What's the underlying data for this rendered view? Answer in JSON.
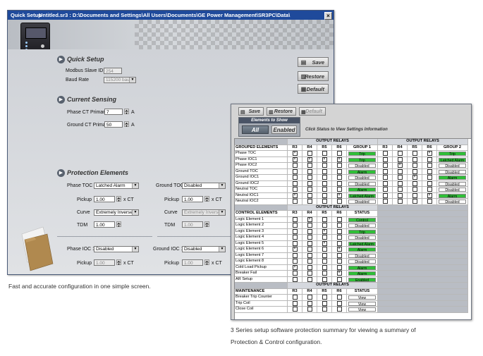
{
  "window1": {
    "title": "Quick Setup",
    "path": "Untitled.sr3 : D:\\Documents and Settings\\All Users\\Documents\\GE Power Management\\SR3PC\\Data\\",
    "close_glyph": "×",
    "quick_setup": {
      "heading": "Quick Setup",
      "modbus_label": "Modbus Slave ID",
      "modbus_value": "254",
      "baud_label": "Baud Rate",
      "baud_value": "115200 baud"
    },
    "current_sensing": {
      "heading": "Current Sensing",
      "phase_ct_label": "Phase CT Primary",
      "phase_ct_value": "7",
      "phase_ct_unit": "A",
      "ground_ct_label": "Ground CT Primary",
      "ground_ct_value": "50",
      "ground_ct_unit": "A"
    },
    "protection": {
      "heading": "Protection Elements",
      "phase_toc_label": "Phase TOC",
      "phase_toc_value": "Latched Alarm",
      "ground_toc_label": "Ground TOC",
      "ground_toc_value": "Disabled",
      "pickup_label": "Pickup",
      "pickup_value_left": "1.00",
      "pickup_value_right": "1.00",
      "pickup_unit": "x CT",
      "curve_label": "Curve",
      "curve_value_left": "Extremely Inverse",
      "curve_value_right": "Extremely Inverse",
      "tdm_label": "TDM",
      "tdm_value_left": "1.00",
      "tdm_value_right": "1.00",
      "phase_ioc_label": "Phase IOC 1",
      "phase_ioc_value": "Disabled",
      "ground_ioc_label": "Ground IOC 1",
      "ground_ioc_value": "Disabled",
      "ioc_pickup_label": "Pickup",
      "ioc_pickup_left": "1.00",
      "ioc_pickup_right": "1.00",
      "ioc_pickup_unit": "x CT"
    },
    "buttons": {
      "save": "Save",
      "restore": "Restore",
      "default": "Default"
    }
  },
  "caption1": "Fast and accurate configuration in one simple screen.",
  "window2": {
    "toolbar": {
      "save": "Save",
      "restore": "Restore",
      "default": "Default"
    },
    "elements_to_show": {
      "heading": "Elements to Show",
      "all": "All",
      "enabled": "Enabled"
    },
    "hint": "Click Status to View Settings Information",
    "output_relays_label": "OUTPUT RELAYS",
    "relay_cols": [
      "R3",
      "R4",
      "R5",
      "R6"
    ],
    "grouped": {
      "header": "GROUPED ELEMENTS",
      "group1_label": "GROUP 1",
      "group2_label": "GROUP 2",
      "rows": [
        {
          "name": "Phase TOC",
          "g1": [
            1,
            0,
            0,
            0
          ],
          "s1": "Trip",
          "s1c": "green",
          "g2": [
            0,
            0,
            0,
            1
          ],
          "s2": "Trip",
          "s2c": "green"
        },
        {
          "name": "Phase IOC1",
          "g1": [
            1,
            1,
            1,
            1
          ],
          "s1": "Trip",
          "s1c": "green",
          "g2": [
            0,
            0,
            0,
            0
          ],
          "s2": "Latched Alarm",
          "s2c": "green"
        },
        {
          "name": "Phase IOC2",
          "g1": [
            0,
            0,
            0,
            0
          ],
          "s1": "Disabled",
          "s1c": "white",
          "g2": [
            0,
            1,
            0,
            0
          ],
          "s2": "Disabled",
          "s2c": "white"
        },
        {
          "name": "Ground TOC",
          "g1": [
            0,
            0,
            0,
            0
          ],
          "s1": "Alarm",
          "s1c": "green",
          "g2": [
            0,
            0,
            0,
            0
          ],
          "s2": "Disabled",
          "s2c": "white"
        },
        {
          "name": "Ground IOC1",
          "g1": [
            0,
            0,
            0,
            0
          ],
          "s1": "Disabled",
          "s1c": "white",
          "g2": [
            0,
            0,
            1,
            0
          ],
          "s2": "Alarm",
          "s2c": "green"
        },
        {
          "name": "Ground IOC2",
          "g1": [
            0,
            0,
            0,
            0
          ],
          "s1": "Disabled",
          "s1c": "white",
          "g2": [
            0,
            0,
            0,
            0
          ],
          "s2": "Disabled",
          "s2c": "white"
        },
        {
          "name": "Neutral TOC",
          "g1": [
            0,
            0,
            0,
            0
          ],
          "s1": "Alarm",
          "s1c": "green",
          "g2": [
            0,
            0,
            0,
            0
          ],
          "s2": "Disabled",
          "s2c": "white"
        },
        {
          "name": "Neutral IOC1",
          "g1": [
            1,
            0,
            0,
            1
          ],
          "s1": "Latched Alarm",
          "s1c": "green",
          "g2": [
            0,
            0,
            0,
            1
          ],
          "s2": "Alarm",
          "s2c": "green"
        },
        {
          "name": "Neutral IOC2",
          "g1": [
            0,
            0,
            0,
            0
          ],
          "s1": "Disabled",
          "s1c": "white",
          "g2": [
            0,
            0,
            0,
            0
          ],
          "s2": "Disabled",
          "s2c": "white"
        }
      ]
    },
    "control": {
      "header": "CONTROL ELEMENTS",
      "status_label": "STATUS",
      "rows": [
        {
          "name": "Logic Element 1",
          "r": [
            0,
            1,
            0,
            0
          ],
          "s": "Control",
          "c": "green"
        },
        {
          "name": "Logic Element 2",
          "r": [
            0,
            0,
            0,
            0
          ],
          "s": "Disabled",
          "c": "white"
        },
        {
          "name": "Logic Element 3",
          "r": [
            0,
            0,
            1,
            0
          ],
          "s": "Trip",
          "c": "green"
        },
        {
          "name": "Logic Element 4",
          "r": [
            0,
            0,
            0,
            0
          ],
          "s": "Disabled",
          "c": "white"
        },
        {
          "name": "Logic Element 5",
          "r": [
            0,
            0,
            1,
            0
          ],
          "s": "Latched Alarm",
          "c": "green"
        },
        {
          "name": "Logic Element 6",
          "r": [
            1,
            0,
            0,
            1
          ],
          "s": "Alarm",
          "c": "green"
        },
        {
          "name": "Logic Element 7",
          "r": [
            0,
            0,
            0,
            0
          ],
          "s": "Disabled",
          "c": "white"
        },
        {
          "name": "Logic Element 8",
          "r": [
            0,
            0,
            0,
            0
          ],
          "s": "Disabled",
          "c": "white"
        },
        {
          "name": "Cold Load Pickup",
          "r": [
            1,
            0,
            0,
            0
          ],
          "s": "Alarm",
          "c": "green"
        },
        {
          "name": "Breaker Fail",
          "r": [
            0,
            0,
            0,
            1
          ],
          "s": "Alarm",
          "c": "green"
        },
        {
          "name": "AR Setup",
          "r": [
            0,
            0,
            0,
            0
          ],
          "s": "Enabled",
          "c": "green"
        }
      ]
    },
    "maintenance": {
      "header": "MAINTENANCE",
      "status_label": "STATUS",
      "rows": [
        {
          "name": "Breaker Trip Counter",
          "r": [
            0,
            0,
            0,
            0
          ],
          "s": "View",
          "c": "white"
        },
        {
          "name": "Trip Coil",
          "r": [
            0,
            0,
            0,
            0
          ],
          "s": "View",
          "c": "white"
        },
        {
          "name": "Close Coil",
          "r": [
            0,
            0,
            0,
            0
          ],
          "s": "View",
          "c": "white"
        }
      ]
    }
  },
  "caption2_line1": "3 Series setup software protection summary for viewing a summary of",
  "caption2_line2": "Protection & Control configuration.",
  "colors": {
    "title_bar": "#1f4a9b",
    "status_green": "#2fbe37",
    "header_strip": "#4a5466"
  }
}
